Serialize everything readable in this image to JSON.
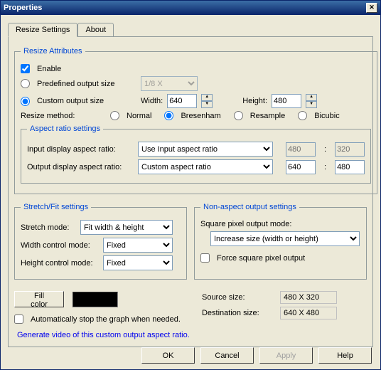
{
  "title": "Properties",
  "tabs": {
    "resize": "Resize Settings",
    "about": "About"
  },
  "attr": {
    "legend": "Resize Attributes",
    "enable": "Enable",
    "predef": "Predefined output size",
    "predef_val": "1/8 X",
    "custom": "Custom output size",
    "width_lbl": "Width:",
    "width": "640",
    "height_lbl": "Height:",
    "height": "480",
    "method_lbl": "Resize method:",
    "m_normal": "Normal",
    "m_bres": "Bresenham",
    "m_res": "Resample",
    "m_bic": "Bicubic"
  },
  "ar": {
    "legend": "Aspect ratio settings",
    "in_lbl": "Input display aspect ratio:",
    "in_val": "Use Input aspect ratio",
    "in_w": "480",
    "in_h": "320",
    "out_lbl": "Output display aspect ratio:",
    "out_val": "Custom aspect ratio",
    "out_w": "640",
    "out_h": "480"
  },
  "sf": {
    "legend": "Stretch/Fit settings",
    "stretch_lbl": "Stretch mode:",
    "stretch_val": "Fit width & height",
    "wctrl_lbl": "Width control mode:",
    "wctrl_val": "Fixed",
    "hctrl_lbl": "Height control mode:",
    "hctrl_val": "Fixed"
  },
  "na": {
    "legend": "Non-aspect output settings",
    "sq_lbl": "Square pixel output mode:",
    "sq_val": "Increase size (width or height)",
    "force": "Force square pixel output"
  },
  "fill": "Fill color",
  "autostop": "Automatically stop the graph when needed.",
  "src_lbl": "Source size:",
  "src_val": "480 X 320",
  "dst_lbl": "Destination size:",
  "dst_val": "640 X 480",
  "link": "Generate video of this custom output aspect ratio.",
  "btn": {
    "ok": "OK",
    "cancel": "Cancel",
    "apply": "Apply",
    "help": "Help"
  }
}
